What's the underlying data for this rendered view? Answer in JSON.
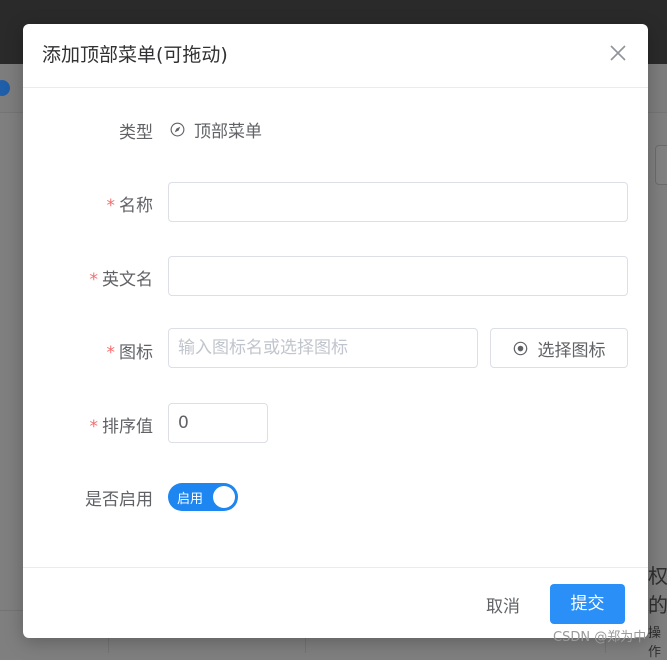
{
  "dialog": {
    "title": "添加顶部菜单(可拖动)",
    "close_icon": "close-icon"
  },
  "form": {
    "type": {
      "label": "类型",
      "value": "顶部菜单",
      "icon": "compass-icon"
    },
    "name": {
      "required_mark": "*",
      "label": "名称",
      "value": "",
      "placeholder": ""
    },
    "english_name": {
      "required_mark": "*",
      "label": "英文名",
      "value": "",
      "placeholder": ""
    },
    "icon": {
      "required_mark": "*",
      "label": "图标",
      "value": "",
      "placeholder": "输入图标名或选择图标",
      "button_label": "选择图标",
      "button_icon": "target-icon"
    },
    "sort": {
      "required_mark": "*",
      "label": "排序值",
      "value": "0"
    },
    "enabled": {
      "label": "是否启用",
      "switch_text": "启用",
      "on": true
    }
  },
  "footer": {
    "cancel_label": "取消",
    "submit_label": "提交"
  },
  "colors": {
    "primary": "#2a8ff7",
    "switch_on": "#1d86f0",
    "required": "#f56c6c"
  },
  "background": {
    "fragment_text_1": "权的",
    "fragment_text_2": "操作"
  },
  "watermark": "CSDN @郑为中"
}
